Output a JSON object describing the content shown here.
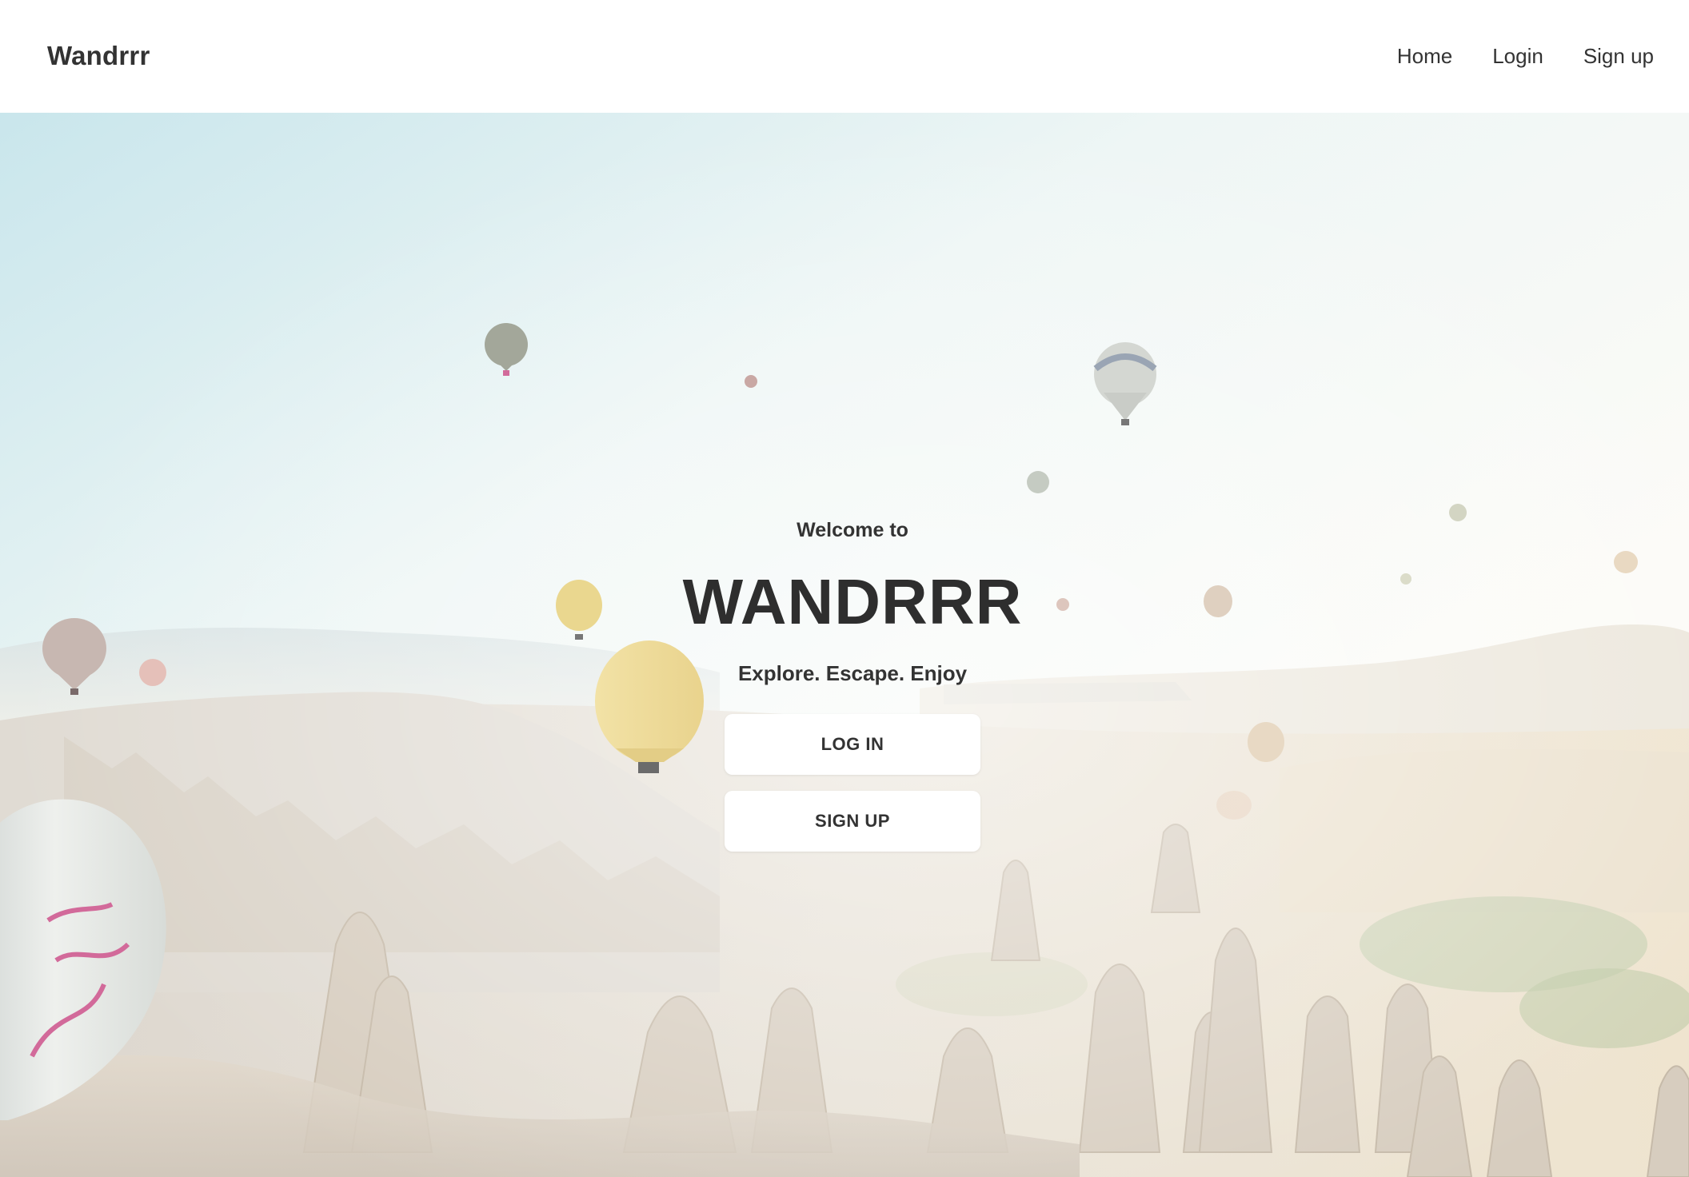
{
  "navbar": {
    "brand": "Wandrrr",
    "links": [
      {
        "label": "Home"
      },
      {
        "label": "Login"
      },
      {
        "label": "Sign up"
      }
    ]
  },
  "hero": {
    "welcome": "Welcome to",
    "title": "WANDRRR",
    "tagline": "Explore. Escape. Enjoy",
    "login_button": "LOG IN",
    "signup_button": "SIGN UP"
  },
  "colors": {
    "text": "#333333",
    "button_bg": "#ffffff",
    "sky_top": "#cde9ee",
    "sky_bottom": "#fdfcf8",
    "rock": "#e4dcd0"
  }
}
